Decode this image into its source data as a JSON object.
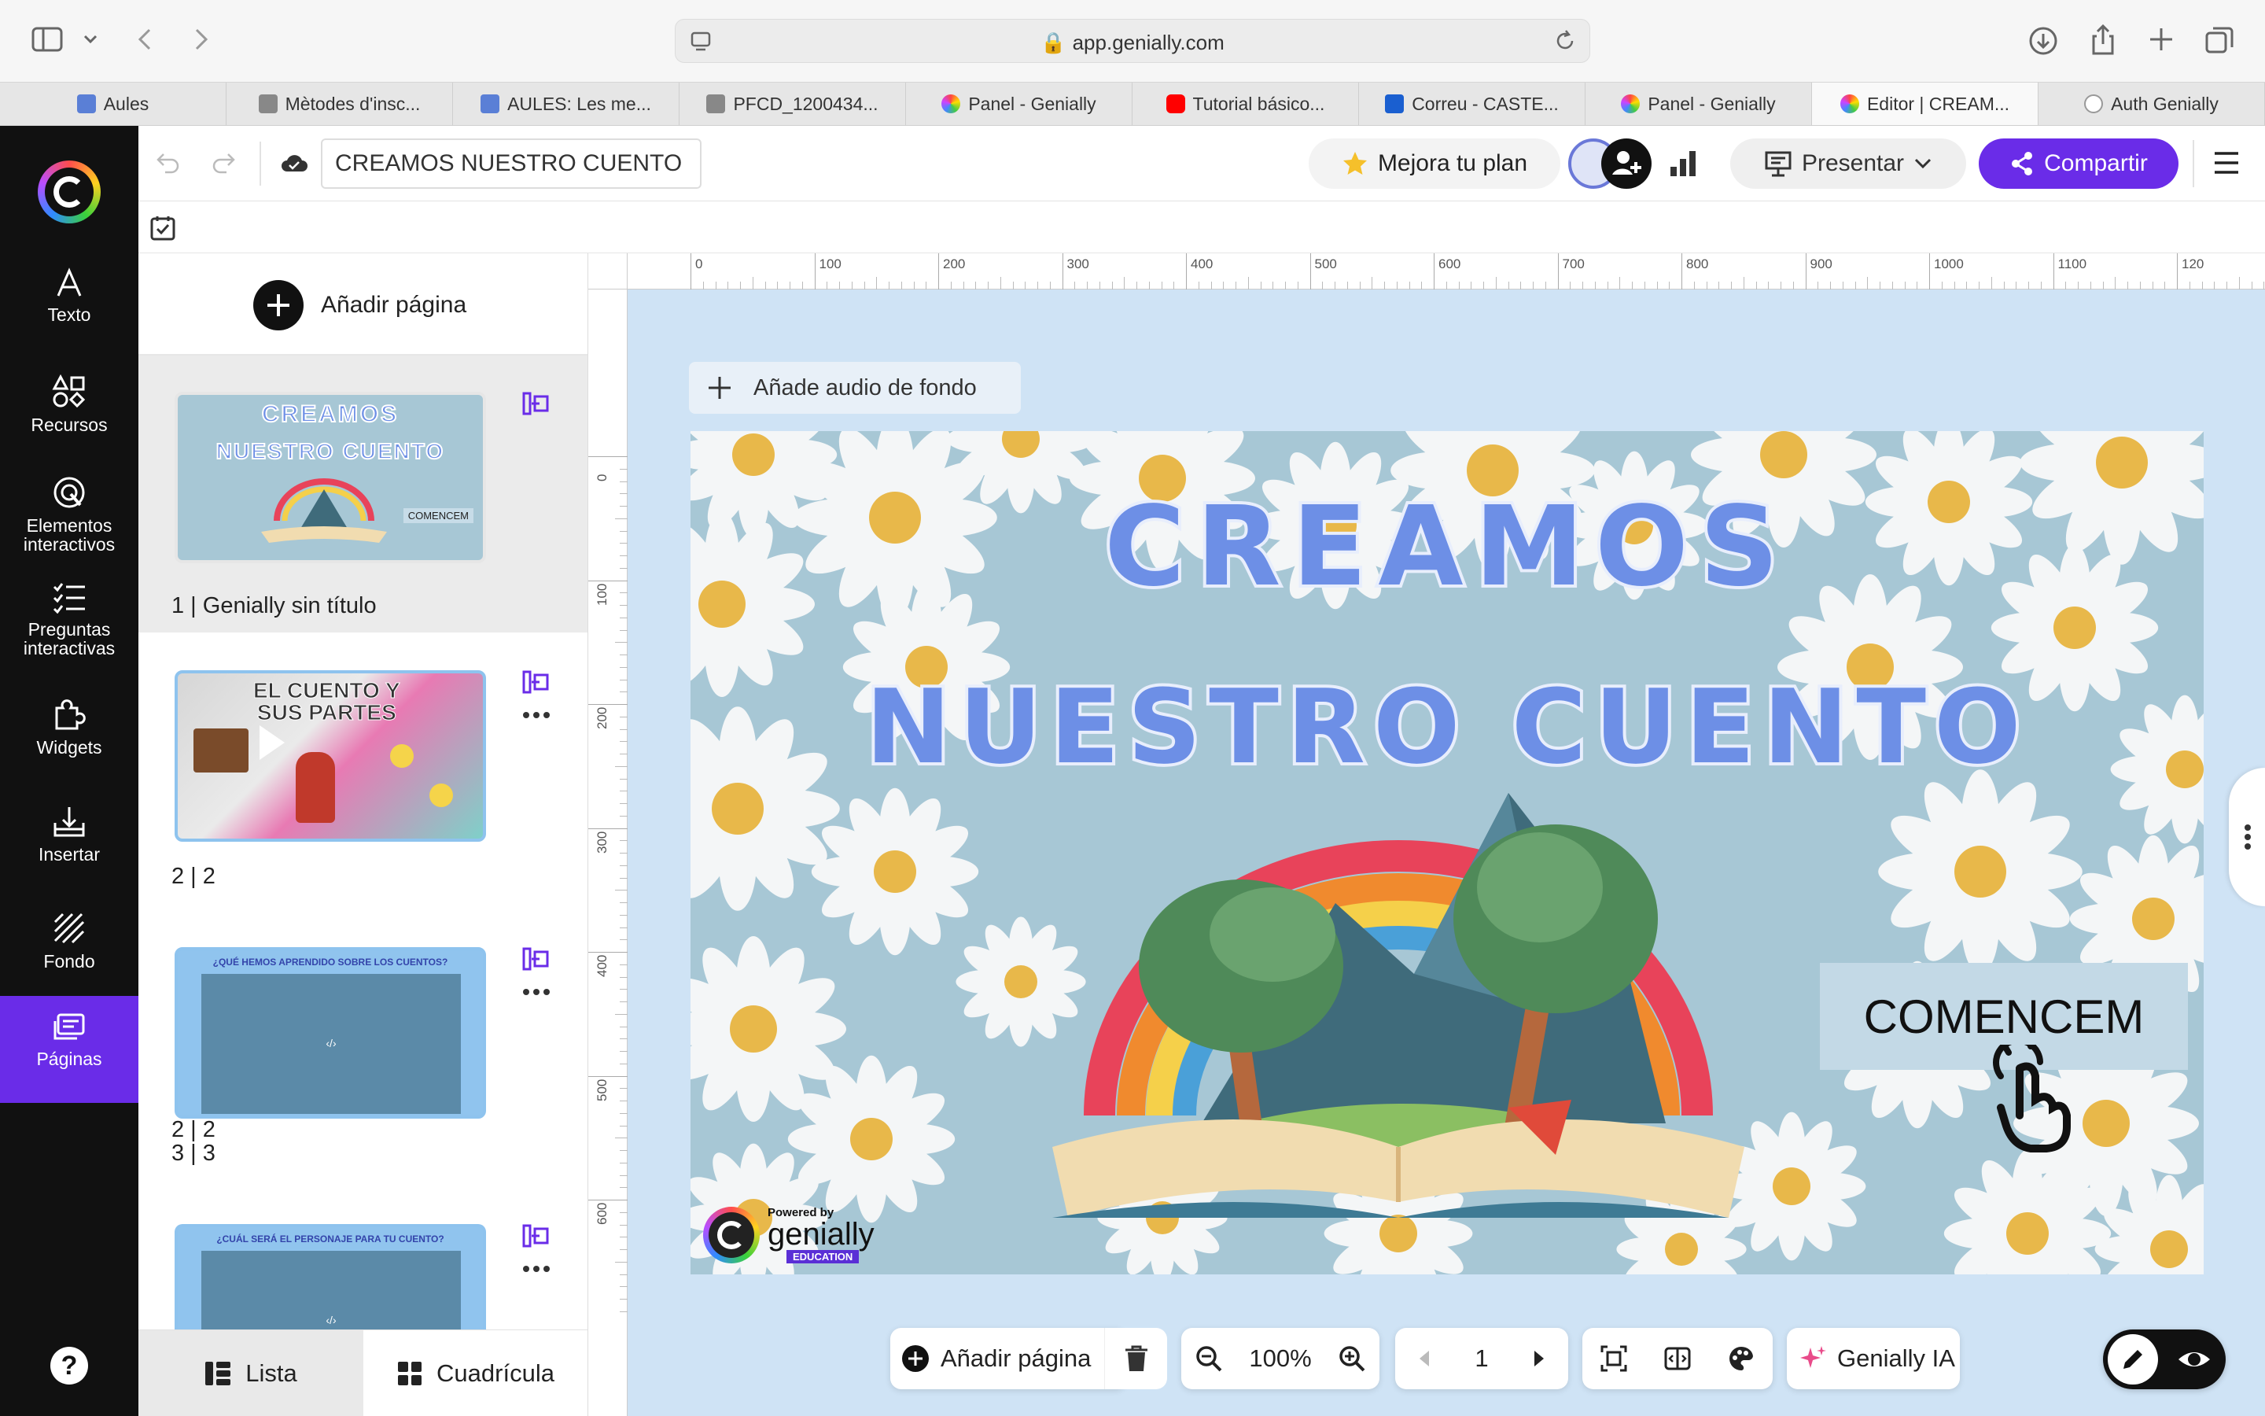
{
  "browser": {
    "url": "app.genially.com",
    "tabs": [
      {
        "label": "Aules",
        "color": "#5a7fd6"
      },
      {
        "label": "Mètodes d'insc...",
        "color": "#888888"
      },
      {
        "label": "AULES: Les me...",
        "color": "#5a7fd6"
      },
      {
        "label": "PFCD_1200434...",
        "color": "#888888"
      },
      {
        "label": "Panel - Genially",
        "color": "#222222"
      },
      {
        "label": "Tutorial básico...",
        "color": "#ff0000"
      },
      {
        "label": "Correu - CASTE...",
        "color": "#1a5fd0"
      },
      {
        "label": "Panel - Genially",
        "color": "#222222"
      },
      {
        "label": "Editor | CREAM...",
        "color": "#222222"
      },
      {
        "label": "Auth Genially",
        "color": "#999999"
      }
    ],
    "active_tab": 8
  },
  "sidebar": {
    "items": [
      {
        "label": "Texto",
        "icon": "text-icon"
      },
      {
        "label": "Recursos",
        "icon": "resources-icon"
      },
      {
        "label": "Elementos interactivos",
        "icon": "interactive-icon"
      },
      {
        "label": "Preguntas interactivas",
        "icon": "questions-icon"
      },
      {
        "label": "Widgets",
        "icon": "widgets-icon"
      },
      {
        "label": "Insertar",
        "icon": "insert-icon"
      },
      {
        "label": "Fondo",
        "icon": "background-icon"
      },
      {
        "label": "Páginas",
        "icon": "pages-icon"
      }
    ],
    "active": "Páginas",
    "help": "?"
  },
  "toolbar": {
    "title": "CREAMOS NUESTRO CUENTO",
    "upgrade": "Mejora tu plan",
    "present": "Presentar",
    "share": "Compartir"
  },
  "panel": {
    "add_page": "Añadir página",
    "pages": [
      {
        "label": "1 |  Genially sin título",
        "thumb_title_1": "CREAMOS",
        "thumb_title_2": "NUESTRO CUENTO",
        "thumb_btn": "COMENCEM"
      },
      {
        "label": "2 |  2",
        "thumb_title_1": "EL CUENTO Y",
        "thumb_title_2": "SUS PARTES"
      },
      {
        "label": "3 |  3",
        "thumb_title_1": "¿QUÉ HEMOS APRENDIDO SOBRE LOS CUENTOS?"
      },
      {
        "label": "",
        "thumb_title_1": "¿CUÁL SERÁ EL PERSONAJE PARA TU CUENTO?"
      }
    ],
    "view_list": "Lista",
    "view_grid": "Cuadrícula"
  },
  "canvas": {
    "audio": "Añade audio de fondo",
    "ruler_h": [
      "0",
      "100",
      "200",
      "300",
      "400",
      "500",
      "600",
      "700",
      "800",
      "900",
      "1000",
      "1100",
      "120"
    ],
    "ruler_v": [
      "0",
      "100",
      "200",
      "300",
      "400",
      "500",
      "600"
    ],
    "slide": {
      "title_1": "CREAMOS",
      "title_2": "NUESTRO CUENTO",
      "button": "COMENCEM",
      "powered_by": "Powered by",
      "brand": "genially",
      "edition": "EDUCATION"
    }
  },
  "bottom": {
    "add_page": "Añadir página",
    "zoom": "100%",
    "page": "1",
    "ai": "Genially IA"
  },
  "colors": {
    "accent": "#6a2ce8",
    "slide_bg": "#a7c7d5",
    "title": "#6d8fe6",
    "canvas_bg": "#cfe3f5"
  }
}
